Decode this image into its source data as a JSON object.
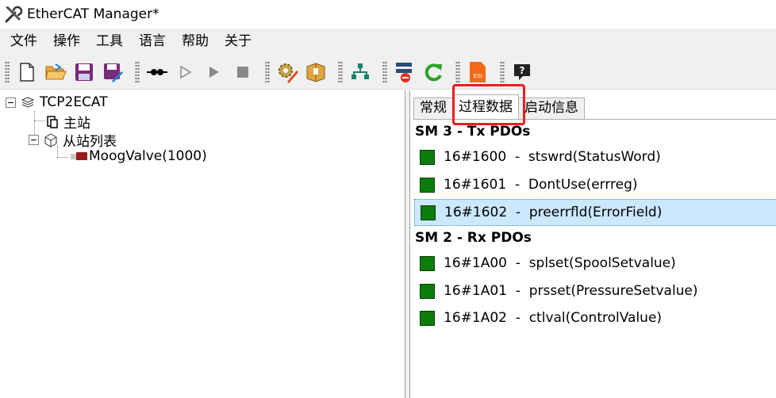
{
  "window": {
    "title": "EtherCAT Manager*"
  },
  "menu": [
    "文件",
    "操作",
    "工具",
    "语言",
    "帮助",
    "关于"
  ],
  "toolbar": {
    "groups": [
      [
        "new-file-icon",
        "open-folder-icon",
        "save-icon",
        "save-as-icon"
      ],
      [
        "connect-icon",
        "play-outline-icon",
        "play-icon",
        "stop-icon"
      ],
      [
        "settings-edit-icon",
        "package-icon"
      ],
      [
        "network-icon"
      ],
      [
        "remove-device-icon",
        "refresh-icon"
      ],
      [
        "esi-file-icon"
      ],
      [
        "help-icon"
      ]
    ],
    "esi_label": "ESI",
    "help_label": "?"
  },
  "tree": {
    "root": "TCP2ECAT",
    "master": "主站",
    "slave_list": "从站列表",
    "slave": "MoogValve(1000)"
  },
  "tabs": [
    "常规",
    "过程数据",
    "启动信息"
  ],
  "active_tab": "过程数据",
  "sections": [
    {
      "title": "SM 3 - Tx PDOs",
      "rows": [
        {
          "index": "16#1600",
          "name": "stswrd(StatusWord)",
          "checked": true,
          "selected": false
        },
        {
          "index": "16#1601",
          "name": "DontUse(errreg)",
          "checked": true,
          "selected": false
        },
        {
          "index": "16#1602",
          "name": "preerrfld(ErrorField)",
          "checked": true,
          "selected": true
        }
      ]
    },
    {
      "title": "SM 2 - Rx PDOs",
      "rows": [
        {
          "index": "16#1A00",
          "name": "splset(SpoolSetvalue)",
          "checked": true,
          "selected": false
        },
        {
          "index": "16#1A01",
          "name": "prsset(PressureSetvalue)",
          "checked": true,
          "selected": false
        },
        {
          "index": "16#1A02",
          "name": "ctlval(ControlValue)",
          "checked": true,
          "selected": false
        }
      ]
    }
  ],
  "row_separator": "  -  ",
  "colors": {
    "checked": "#0a7d0a",
    "selection": "#cce8ff",
    "highlight_box": "#ee1c1c"
  }
}
